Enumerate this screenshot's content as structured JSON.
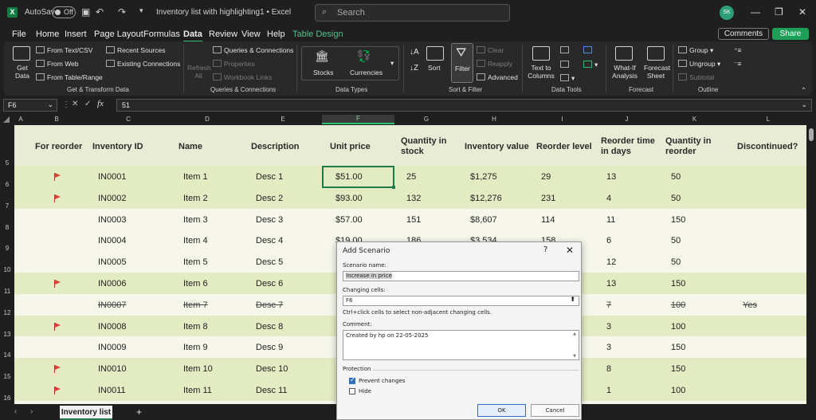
{
  "titlebar": {
    "logo": "X",
    "autosave_label": "AutoSave",
    "autosave_state": "Off",
    "doc_title": "Inventory list with highlighting1 • Excel",
    "search_placeholder": "Search",
    "avatar_initials": "SK"
  },
  "menu": {
    "items": [
      "File",
      "Home",
      "Insert",
      "Page Layout",
      "Formulas",
      "Data",
      "Review",
      "View",
      "Help",
      "Table Design"
    ],
    "active": "Data",
    "comments": "Comments",
    "share": "Share"
  },
  "ribbon": {
    "get_data": "Get Data",
    "from_text_csv": "From Text/CSV",
    "from_web": "From Web",
    "from_table_range": "From Table/Range",
    "recent_sources": "Recent Sources",
    "existing_connections": "Existing Connections",
    "group_get_transform": "Get & Transform Data",
    "refresh_all": "Refresh All",
    "queries_connections": "Queries & Connections",
    "properties": "Properties",
    "workbook_links": "Workbook Links",
    "group_queries": "Queries & Connections",
    "stocks": "Stocks",
    "currencies": "Currencies",
    "group_data_types": "Data Types",
    "sort": "Sort",
    "filter": "Filter",
    "clear": "Clear",
    "reapply": "Reapply",
    "advanced": "Advanced",
    "group_sort_filter": "Sort & Filter",
    "text_to_columns": "Text to Columns",
    "group_data_tools": "Data Tools",
    "what_if": "What-If Analysis",
    "forecast_sheet": "Forecast Sheet",
    "group_forecast": "Forecast",
    "group": "Group",
    "ungroup": "Ungroup",
    "subtotal": "Subtotal",
    "group_outline": "Outline"
  },
  "formula": {
    "namebox": "F6",
    "fx": "fx",
    "value": "51"
  },
  "columns": [
    "A",
    "B",
    "C",
    "D",
    "E",
    "F",
    "G",
    "H",
    "I",
    "J",
    "K",
    "L"
  ],
  "table": {
    "headers": [
      "For reorder",
      "Inventory ID",
      "Name",
      "Description",
      "Unit price",
      "Quantity in stock",
      "Inventory value",
      "Reorder level",
      "Reorder time in days",
      "Quantity in reorder",
      "Discontinued?"
    ],
    "rows": [
      {
        "row": "6",
        "flag": true,
        "id": "IN0001",
        "name": "Item 1",
        "desc": "Desc 1",
        "price": "$51.00",
        "qty": "25",
        "value": "$1,275",
        "level": "29",
        "days": "13",
        "reorder": "50",
        "disc": "",
        "strike": false
      },
      {
        "row": "7",
        "flag": true,
        "id": "IN0002",
        "name": "Item 2",
        "desc": "Desc 2",
        "price": "$93.00",
        "qty": "132",
        "value": "$12,276",
        "level": "231",
        "days": "4",
        "reorder": "50",
        "disc": "",
        "strike": false
      },
      {
        "row": "8",
        "flag": false,
        "id": "IN0003",
        "name": "Item 3",
        "desc": "Desc 3",
        "price": "$57.00",
        "qty": "151",
        "value": "$8,607",
        "level": "114",
        "days": "11",
        "reorder": "150",
        "disc": "",
        "strike": false
      },
      {
        "row": "9",
        "flag": false,
        "id": "IN0004",
        "name": "Item 4",
        "desc": "Desc 4",
        "price": "$19.00",
        "qty": "186",
        "value": "$3,534",
        "level": "158",
        "days": "6",
        "reorder": "50",
        "disc": "",
        "strike": false
      },
      {
        "row": "10",
        "flag": false,
        "id": "IN0005",
        "name": "Item 5",
        "desc": "Desc 5",
        "price": "",
        "qty": "",
        "value": "",
        "level": "",
        "days": "12",
        "reorder": "50",
        "disc": "",
        "strike": false
      },
      {
        "row": "11",
        "flag": true,
        "id": "IN0006",
        "name": "Item 6",
        "desc": "Desc 6",
        "price": "",
        "qty": "",
        "value": "",
        "level": "",
        "days": "13",
        "reorder": "150",
        "disc": "",
        "strike": false
      },
      {
        "row": "12",
        "flag": false,
        "id": "IN0007",
        "name": "Item 7",
        "desc": "Desc 7",
        "price": "",
        "qty": "",
        "value": "",
        "level": "",
        "days": "7",
        "reorder": "100",
        "disc": "Yes",
        "strike": true
      },
      {
        "row": "13",
        "flag": true,
        "id": "IN0008",
        "name": "Item 8",
        "desc": "Desc 8",
        "price": "",
        "qty": "",
        "value": "",
        "level": "",
        "days": "3",
        "reorder": "100",
        "disc": "",
        "strike": false
      },
      {
        "row": "14",
        "flag": false,
        "id": "IN0009",
        "name": "Item 9",
        "desc": "Desc 9",
        "price": "",
        "qty": "",
        "value": "",
        "level": "",
        "days": "3",
        "reorder": "150",
        "disc": "",
        "strike": false
      },
      {
        "row": "15",
        "flag": true,
        "id": "IN0010",
        "name": "Item 10",
        "desc": "Desc 10",
        "price": "",
        "qty": "",
        "value": "",
        "level": "",
        "days": "8",
        "reorder": "150",
        "disc": "",
        "strike": false
      },
      {
        "row": "16",
        "flag": true,
        "id": "IN0011",
        "name": "Item 11",
        "desc": "Desc 11",
        "price": "",
        "qty": "",
        "value": "",
        "level": "",
        "days": "1",
        "reorder": "100",
        "disc": "",
        "strike": false
      }
    ]
  },
  "row5_label": "5",
  "sheet_tab": "Inventory list",
  "add_sheet": "+",
  "dialog": {
    "title": "Add Scenario",
    "help": "?",
    "close": "✕",
    "scenario_name_label": "Scenario name:",
    "scenario_name_value": "Increase in price",
    "changing_cells_label": "Changing cells:",
    "changing_cells_value": "F6",
    "hint": "Ctrl+click cells to select non-adjacent changing cells.",
    "comment_label": "Comment:",
    "comment_value": "Created by hp on 22-05-2025",
    "protection_label": "Protection",
    "prevent_changes": "Prevent changes",
    "prevent_changes_checked": true,
    "hide": "Hide",
    "hide_checked": false,
    "ok": "OK",
    "cancel": "Cancel"
  }
}
